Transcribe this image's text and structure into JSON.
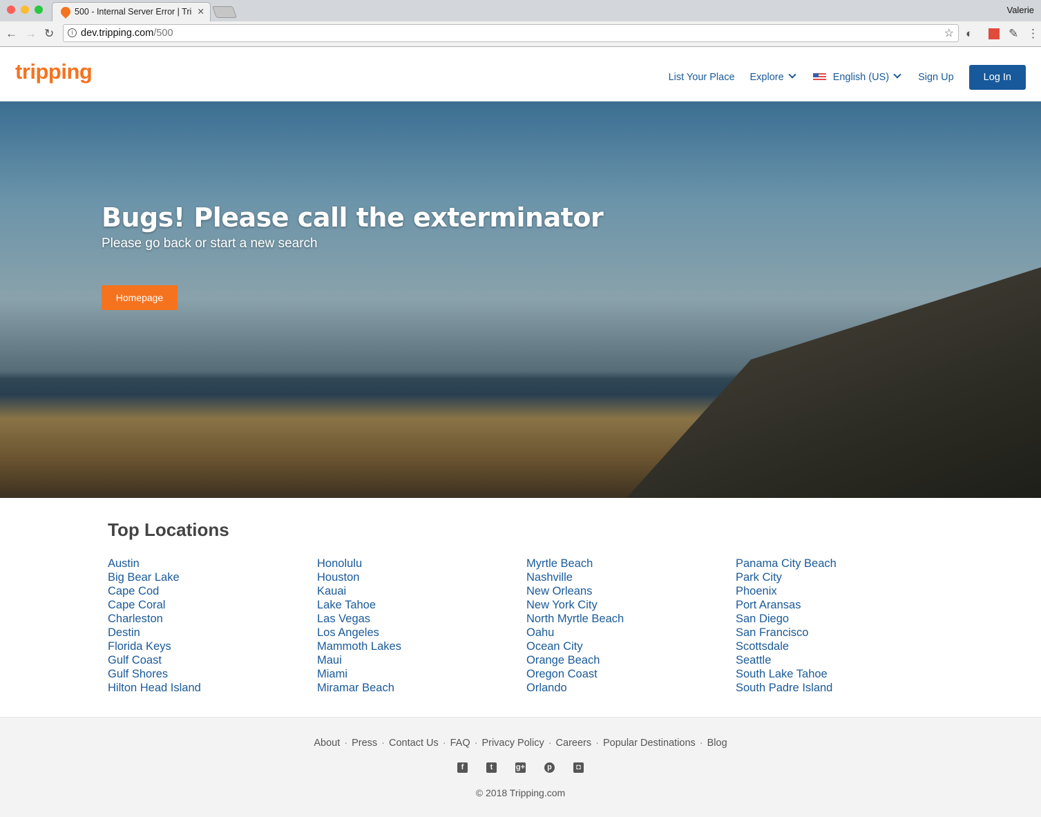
{
  "browser": {
    "tab_title": "500 - Internal Server Error | Tri",
    "user": "Valerie",
    "url_host": "dev.tripping.com",
    "url_path": "/500"
  },
  "header": {
    "logo": "tripping",
    "nav": {
      "list_place": "List Your Place",
      "explore": "Explore",
      "language": "English (US)",
      "sign_up": "Sign Up",
      "log_in": "Log In"
    }
  },
  "hero": {
    "title": "Bugs! Please call the exterminator",
    "subtitle": "Please go back or start a new search",
    "button": "Homepage"
  },
  "top_locations": {
    "title": "Top Locations",
    "columns": [
      [
        "Austin",
        "Big Bear Lake",
        "Cape Cod",
        "Cape Coral",
        "Charleston",
        "Destin",
        "Florida Keys",
        "Gulf Coast",
        "Gulf Shores",
        "Hilton Head Island"
      ],
      [
        "Honolulu",
        "Houston",
        "Kauai",
        "Lake Tahoe",
        "Las Vegas",
        "Los Angeles",
        "Mammoth Lakes",
        "Maui",
        "Miami",
        "Miramar Beach"
      ],
      [
        "Myrtle Beach",
        "Nashville",
        "New Orleans",
        "New York City",
        "North Myrtle Beach",
        "Oahu",
        "Ocean City",
        "Orange Beach",
        "Oregon Coast",
        "Orlando"
      ],
      [
        "Panama City Beach",
        "Park City",
        "Phoenix",
        "Port Aransas",
        "San Diego",
        "San Francisco",
        "Scottsdale",
        "Seattle",
        "South Lake Tahoe",
        "South Padre Island"
      ]
    ]
  },
  "footer": {
    "links": [
      "About",
      "Press",
      "Contact Us",
      "FAQ",
      "Privacy Policy",
      "Careers",
      "Popular Destinations",
      "Blog"
    ],
    "separator": "·",
    "social": [
      "facebook",
      "twitter",
      "google-plus",
      "pinterest",
      "instagram"
    ],
    "copyright": "© 2018 Tripping.com"
  },
  "colors": {
    "brand": "#f5731f",
    "link": "#1a5a99",
    "login": "#17599b"
  }
}
